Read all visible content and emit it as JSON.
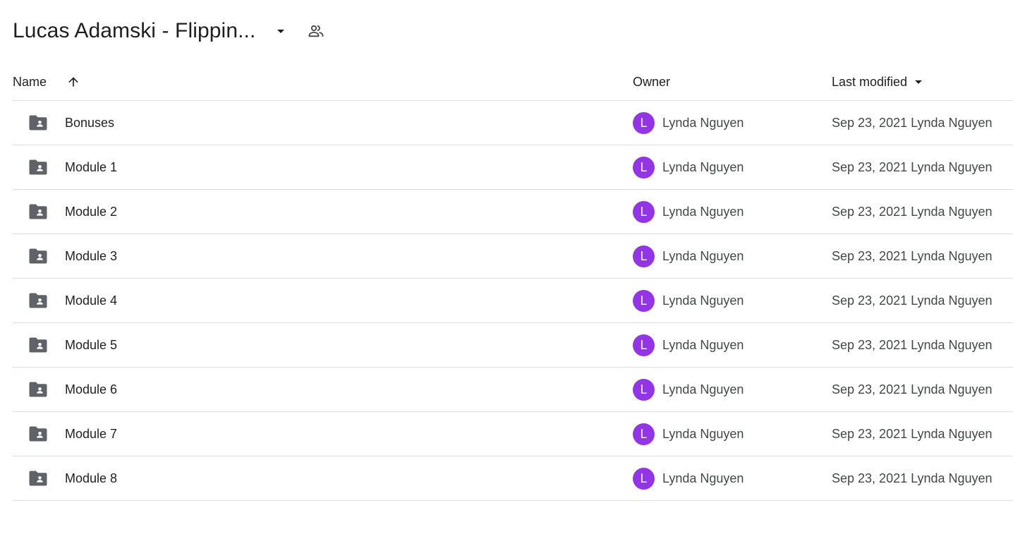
{
  "header": {
    "folder_title": "Lucas Adamski - Flippin...",
    "dropdown_icon": "arrow-drop-down-icon",
    "shared_icon": "people-icon"
  },
  "columns": {
    "name": "Name",
    "owner": "Owner",
    "last_modified": "Last modified",
    "name_sort": "ascending"
  },
  "rows": [
    {
      "name": "Bonuses",
      "avatar_letter": "L",
      "owner": "Lynda Nguyen",
      "modified": "Sep 23, 2021 Lynda Nguyen"
    },
    {
      "name": "Module 1",
      "avatar_letter": "L",
      "owner": "Lynda Nguyen",
      "modified": "Sep 23, 2021 Lynda Nguyen"
    },
    {
      "name": "Module 2",
      "avatar_letter": "L",
      "owner": "Lynda Nguyen",
      "modified": "Sep 23, 2021 Lynda Nguyen"
    },
    {
      "name": "Module 3",
      "avatar_letter": "L",
      "owner": "Lynda Nguyen",
      "modified": "Sep 23, 2021 Lynda Nguyen"
    },
    {
      "name": "Module 4",
      "avatar_letter": "L",
      "owner": "Lynda Nguyen",
      "modified": "Sep 23, 2021 Lynda Nguyen"
    },
    {
      "name": "Module 5",
      "avatar_letter": "L",
      "owner": "Lynda Nguyen",
      "modified": "Sep 23, 2021 Lynda Nguyen"
    },
    {
      "name": "Module 6",
      "avatar_letter": "L",
      "owner": "Lynda Nguyen",
      "modified": "Sep 23, 2021 Lynda Nguyen"
    },
    {
      "name": "Module 7",
      "avatar_letter": "L",
      "owner": "Lynda Nguyen",
      "modified": "Sep 23, 2021 Lynda Nguyen"
    },
    {
      "name": "Module 8",
      "avatar_letter": "L",
      "owner": "Lynda Nguyen",
      "modified": "Sep 23, 2021 Lynda Nguyen"
    }
  ],
  "colors": {
    "avatar": "#9334e6",
    "divider": "#dadce0",
    "icon": "#5f6368"
  }
}
